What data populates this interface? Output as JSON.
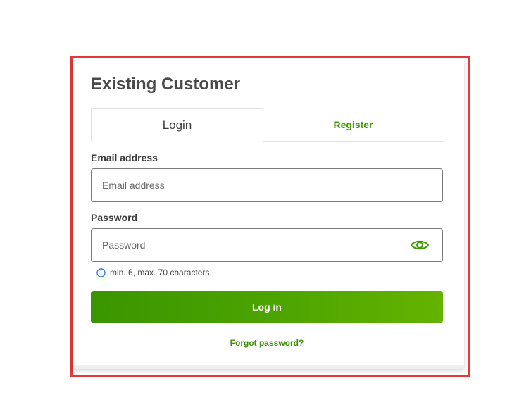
{
  "colors": {
    "highlight_border": "#e23a3a",
    "brand_green": "#3f9a00",
    "button_gradient_start": "#3a9500",
    "button_gradient_end": "#64b300",
    "title_text": "#4a4a4a"
  },
  "card": {
    "title": "Existing Customer"
  },
  "tabs": {
    "login_label": "Login",
    "register_label": "Register",
    "active": "Login"
  },
  "form": {
    "email": {
      "label": "Email address",
      "placeholder": "Email address",
      "value": ""
    },
    "password": {
      "label": "Password",
      "placeholder": "Password",
      "value": "",
      "toggle_icon": "eye-icon",
      "hint": "min. 6, max. 70 characters",
      "hint_icon": "info-icon"
    },
    "submit_label": "Log in",
    "forgot_label": "Forgot password?"
  }
}
